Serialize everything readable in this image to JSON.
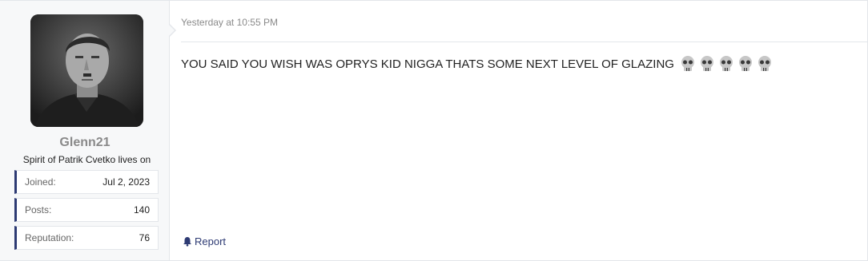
{
  "user": {
    "username": "Glenn21",
    "title": "Spirit of Patrik Cvetko lives on",
    "stats": [
      {
        "label": "Joined:",
        "value": "Jul 2, 2023"
      },
      {
        "label": "Posts:",
        "value": "140"
      },
      {
        "label": "Reputation:",
        "value": "76"
      }
    ]
  },
  "post": {
    "timestamp": "Yesterday at 10:55 PM",
    "message": "YOU SAID YOU WISH WAS OPRYS KID NIGGA THATS SOME NEXT LEVEL OF GLAZING",
    "emoji": [
      "skull-emoji",
      "skull-emoji",
      "skull-emoji",
      "skull-emoji",
      "skull-emoji"
    ],
    "report_label": "Report"
  },
  "colors": {
    "accent": "#2d3a73",
    "muted": "#8a8a8a",
    "border": "#e3e6ea"
  }
}
